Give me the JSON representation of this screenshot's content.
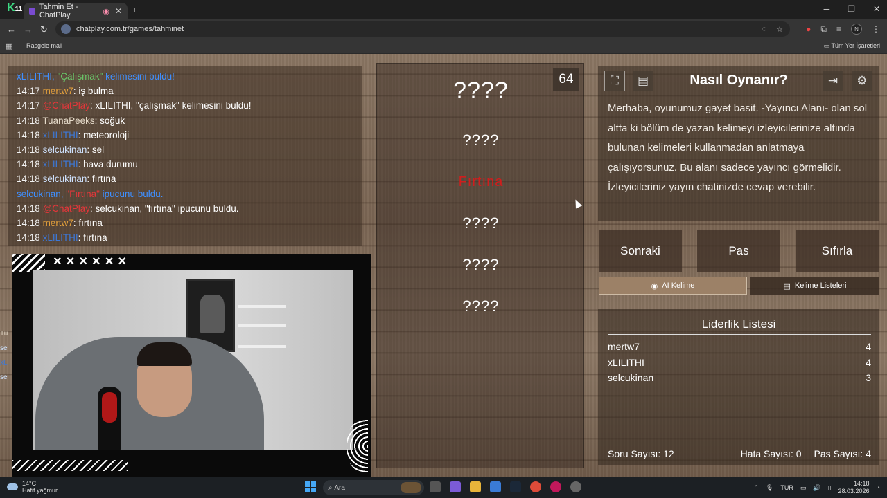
{
  "browser": {
    "tab_title": "Tahmin Et - ChatPlay",
    "new_tab_glyph": "+",
    "url": "chatplay.com.tr/games/tahminet",
    "bookmark_1": "Rasgele mail",
    "bookmark_all": "Tüm Yer İşaretleri",
    "logo_letter": "K",
    "logo_suffix": "11",
    "profile_initial": "N"
  },
  "chat": {
    "lines": [
      {
        "time": "",
        "user": "xLILITHI, \"Çalışmak\" kelimesini buldu!",
        "msg": ""
      },
      {
        "time": "14:17",
        "user": "mertw7",
        "msg": ": iş bulma"
      },
      {
        "time": "14:17",
        "user": "@ChatPlay",
        "msg": ": xLILITHI, \"çalışmak\" kelimesini buldu!"
      },
      {
        "time": "14:18",
        "user": "TuanaPeeks",
        "msg": ": soğuk"
      },
      {
        "time": "14:18",
        "user": "xLILITHI",
        "msg": ": meteoroloji"
      },
      {
        "time": "14:18",
        "user": "selcukinan",
        "msg": ": sel"
      },
      {
        "time": "14:18",
        "user": "xLILITHI",
        "msg": ": hava durumu"
      },
      {
        "time": "14:18",
        "user": "selcukinan",
        "msg": ": fırtına"
      },
      {
        "time": "",
        "user": "selcukinan, \"Fırtına\" ipucunu buldu.",
        "msg": ""
      },
      {
        "time": "14:18",
        "user": "@ChatPlay",
        "msg": ": selcukinan, \"fırtına\" ipucunu buldu."
      },
      {
        "time": "14:18",
        "user": "mertw7",
        "msg": ": fırtına"
      },
      {
        "time": "14:18",
        "user": "xLILITHI",
        "msg": ": fırtına"
      }
    ],
    "sys1_prefix": "xLILITHI, ",
    "sys1_word": "\"Çalışmak\"",
    "sys1_suffix": " kelimesini buldu!",
    "sys2_prefix": "selcukinan, ",
    "sys2_word": "\"Fırtına\"",
    "sys2_suffix": " ipucunu buldu."
  },
  "cam": {
    "crosses": "××××××"
  },
  "left_strip": [
    "Tu",
    "se",
    "xL",
    "se",
    ""
  ],
  "game": {
    "timer": "64",
    "main_word": "????",
    "hints": [
      "????",
      "Fırtına",
      "????",
      "????",
      "????"
    ]
  },
  "rules": {
    "title": "Nasıl Oynanır?",
    "text": "Merhaba, oyunumuz gayet basit. -Yayıncı Alanı- olan sol altta ki bölüm de yazan kelimeyi izleyicilerinize altında bulunan kelimeleri kullanmadan anlatmaya çalışıyorsunuz. Bu alanı sadece yayıncı görmelidir. İzleyicileriniz yayın chatinizde cevap verebilir."
  },
  "buttons": {
    "next": "Sonraki",
    "pass": "Pas",
    "reset": "Sıfırla",
    "ai_word": "AI Kelime",
    "word_lists": "Kelime Listeleri"
  },
  "leaderboard": {
    "title": "Liderlik Listesi",
    "rows": [
      {
        "name": "mertw7",
        "score": "4"
      },
      {
        "name": "xLILITHI",
        "score": "4"
      },
      {
        "name": "selcukinan",
        "score": "3"
      }
    ],
    "question_count": "Soru Sayısı: 12",
    "error_count": "Hata Sayısı: 0",
    "pass_count": "Pas Sayısı: 4"
  },
  "taskbar": {
    "temp": "14°C",
    "weather": "Hafif yağmur",
    "search": "Ara",
    "lang": "TUR",
    "time": "14:18",
    "date": "28.03.2026"
  },
  "colors": {
    "chat_system": "#3f8fff",
    "chatplay_user": "#e6363a",
    "hint_revealed": "#d01d1d"
  }
}
